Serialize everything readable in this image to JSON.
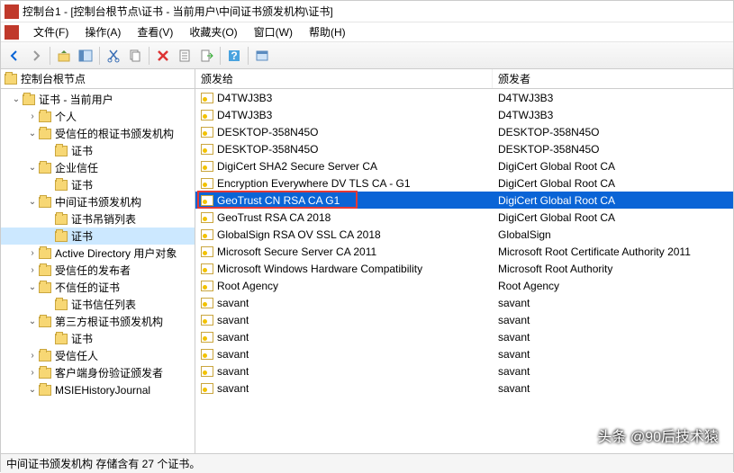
{
  "title": "控制台1 - [控制台根节点\\证书 - 当前用户\\中间证书颁发机构\\证书]",
  "menus": {
    "file": "文件(F)",
    "action": "操作(A)",
    "view": "查看(V)",
    "favorites": "收藏夹(O)",
    "window": "窗口(W)",
    "help": "帮助(H)"
  },
  "tree_header": "控制台根节点",
  "tree": [
    {
      "depth": 0,
      "expand": "open",
      "label": "证书 - 当前用户"
    },
    {
      "depth": 1,
      "expand": "closed",
      "label": "个人"
    },
    {
      "depth": 1,
      "expand": "open",
      "label": "受信任的根证书颁发机构"
    },
    {
      "depth": 2,
      "expand": "none",
      "label": "证书"
    },
    {
      "depth": 1,
      "expand": "open",
      "label": "企业信任"
    },
    {
      "depth": 2,
      "expand": "none",
      "label": "证书"
    },
    {
      "depth": 1,
      "expand": "open",
      "label": "中间证书颁发机构"
    },
    {
      "depth": 2,
      "expand": "none",
      "label": "证书吊销列表"
    },
    {
      "depth": 2,
      "expand": "none",
      "label": "证书",
      "selected": true
    },
    {
      "depth": 1,
      "expand": "closed",
      "label": "Active Directory 用户对象"
    },
    {
      "depth": 1,
      "expand": "closed",
      "label": "受信任的发布者"
    },
    {
      "depth": 1,
      "expand": "open",
      "label": "不信任的证书"
    },
    {
      "depth": 2,
      "expand": "none",
      "label": "证书信任列表"
    },
    {
      "depth": 1,
      "expand": "open",
      "label": "第三方根证书颁发机构"
    },
    {
      "depth": 2,
      "expand": "none",
      "label": "证书"
    },
    {
      "depth": 1,
      "expand": "closed",
      "label": "受信任人"
    },
    {
      "depth": 1,
      "expand": "closed",
      "label": "客户端身份验证颁发者"
    },
    {
      "depth": 1,
      "expand": "open",
      "label": "MSIEHistoryJournal"
    }
  ],
  "columns": {
    "issued_to": "颁发给",
    "issuer": "颁发者"
  },
  "rows": [
    {
      "a": "D4TWJ3B3",
      "b": "D4TWJ3B3"
    },
    {
      "a": "D4TWJ3B3",
      "b": "D4TWJ3B3"
    },
    {
      "a": "DESKTOP-358N45O",
      "b": "DESKTOP-358N45O"
    },
    {
      "a": "DESKTOP-358N45O",
      "b": "DESKTOP-358N45O"
    },
    {
      "a": "DigiCert SHA2 Secure Server CA",
      "b": "DigiCert Global Root CA"
    },
    {
      "a": "Encryption Everywhere DV TLS CA - G1",
      "b": "DigiCert Global Root CA"
    },
    {
      "a": "GeoTrust CN RSA CA G1",
      "b": "DigiCert Global Root CA",
      "selected": true,
      "redbox": true
    },
    {
      "a": "GeoTrust RSA CA 2018",
      "b": "DigiCert Global Root CA"
    },
    {
      "a": "GlobalSign RSA OV SSL CA 2018",
      "b": "GlobalSign"
    },
    {
      "a": "Microsoft Secure Server CA 2011",
      "b": "Microsoft Root Certificate Authority 2011"
    },
    {
      "a": "Microsoft Windows Hardware Compatibility",
      "b": "Microsoft Root Authority"
    },
    {
      "a": "Root Agency",
      "b": "Root Agency"
    },
    {
      "a": "savant",
      "b": "savant"
    },
    {
      "a": "savant",
      "b": "savant"
    },
    {
      "a": "savant",
      "b": "savant"
    },
    {
      "a": "savant",
      "b": "savant"
    },
    {
      "a": "savant",
      "b": "savant"
    },
    {
      "a": "savant",
      "b": "savant"
    }
  ],
  "statusbar": "中间证书颁发机构 存储含有 27 个证书。",
  "watermark": "头条 @90后技术猿"
}
